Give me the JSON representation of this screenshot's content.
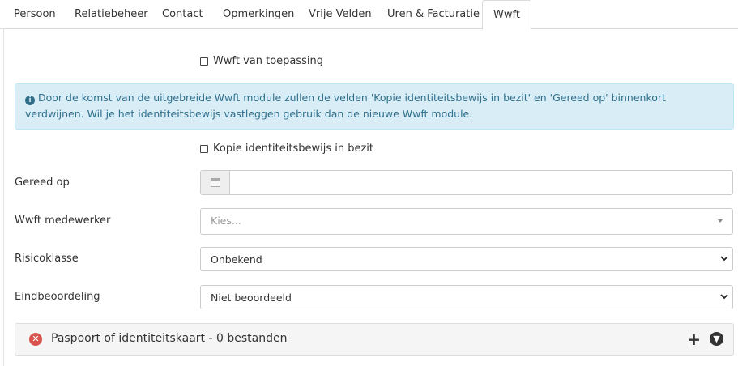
{
  "tabs": [
    {
      "label": "Persoon"
    },
    {
      "label": "Relatiebeheer"
    },
    {
      "label": "Contact"
    },
    {
      "label": "Opmerkingen"
    },
    {
      "label": "Vrije Velden"
    },
    {
      "label": "Uren & Facturatie"
    },
    {
      "label": "Wwft",
      "active": true
    }
  ],
  "form": {
    "wwft_applicable_label": "Wwft van toepassing",
    "info_alert": "Door de komst van de uitgebreide Wwft module zullen de velden 'Kopie identiteitsbewijs in bezit' en 'Gereed op' binnenkort verdwijnen. Wil je het identiteitsbewijs vastleggen gebruik dan de nieuwe Wwft module.",
    "id_copy_label": "Kopie identiteitsbewijs in bezit",
    "ready_on_label": "Gereed op",
    "ready_on_value": "",
    "employee_label": "Wwft medewerker",
    "employee_placeholder": "Kies...",
    "risk_label": "Risicoklasse",
    "risk_value": "Onbekend",
    "final_label": "Eindbeoordeling",
    "final_value": "Niet beoordeeld"
  },
  "panel": {
    "title": "Paspoort of identiteitskaart - 0 bestanden"
  },
  "colors": {
    "alert_bg": "#d9edf7",
    "alert_text": "#2f6f8a",
    "error_icon": "#d9534f"
  }
}
